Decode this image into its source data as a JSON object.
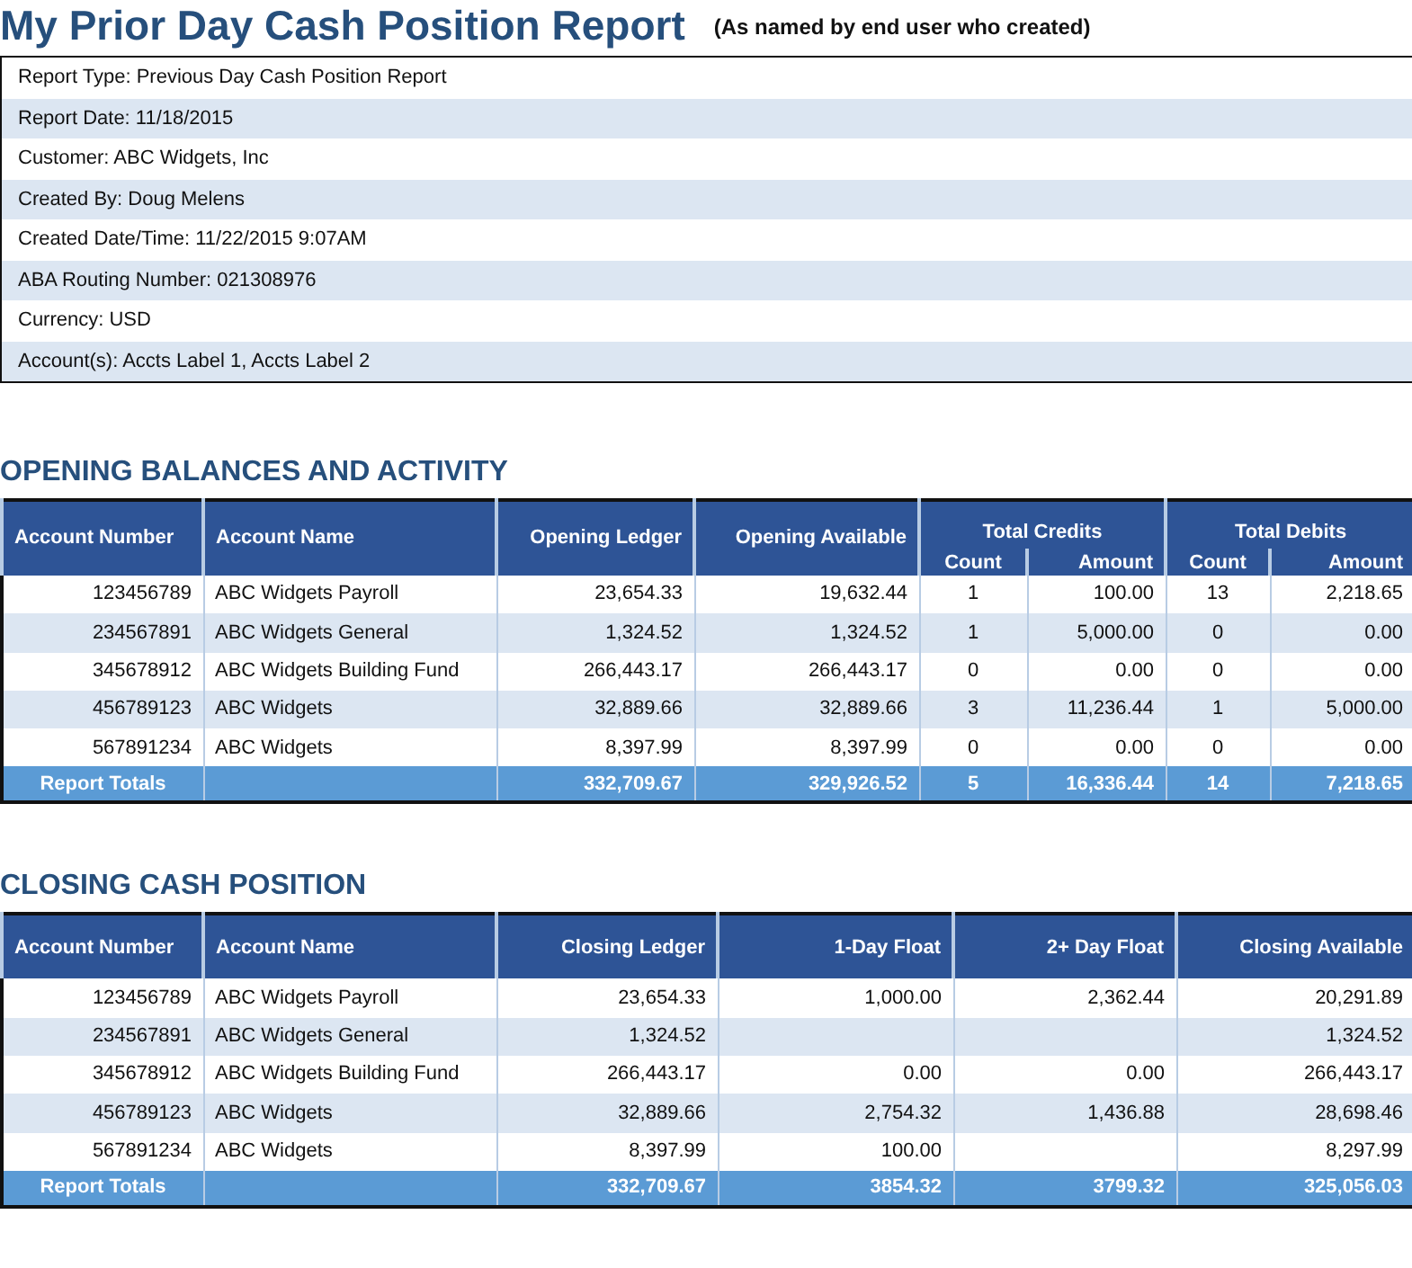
{
  "title": "My Prior Day Cash Position Report",
  "subtitle": "(As named by end user who created)",
  "info_lines": [
    "Report Type: Previous Day Cash Position Report",
    "Report Date:  11/18/2015",
    "Customer: ABC Widgets, Inc",
    "Created By: Doug Melens",
    "Created Date/Time: 11/22/2015 9:07AM",
    "ABA Routing Number: 021308976",
    "Currency: USD",
    "Account(s): Accts Label 1, Accts Label 2"
  ],
  "opening": {
    "heading": "OPENING BALANCES AND ACTIVITY",
    "columns": [
      {
        "label": "Account Number"
      },
      {
        "label": "Account Name"
      },
      {
        "label": "Opening Ledger"
      },
      {
        "label": "Opening Available"
      },
      {
        "label": "Total Credits",
        "sub": [
          "Count",
          "Amount"
        ]
      },
      {
        "label": "Total Debits",
        "sub": [
          "Count",
          "Amount"
        ]
      }
    ],
    "rows": [
      {
        "number": "123456789",
        "name": "ABC Widgets Payroll",
        "values": [
          "23,654.33",
          "19,632.44",
          "1",
          "100.00",
          "13",
          "2,218.65"
        ]
      },
      {
        "number": "234567891",
        "name": "ABC Widgets General",
        "values": [
          "1,324.52",
          "1,324.52",
          "1",
          "5,000.00",
          "0",
          "0.00"
        ]
      },
      {
        "number": "345678912",
        "name": "ABC Widgets Building Fund",
        "values": [
          "266,443.17",
          "266,443.17",
          "0",
          "0.00",
          "0",
          "0.00"
        ]
      },
      {
        "number": "456789123",
        "name": "ABC Widgets",
        "values": [
          "32,889.66",
          "32,889.66",
          "3",
          "11,236.44",
          "1",
          "5,000.00"
        ]
      },
      {
        "number": "567891234",
        "name": "ABC Widgets",
        "values": [
          "8,397.99",
          "8,397.99",
          "0",
          "0.00",
          "0",
          "0.00"
        ]
      }
    ],
    "totals": {
      "label": "Report Totals",
      "values": [
        "332,709.67",
        "329,926.52",
        "5",
        "16,336.44",
        "14",
        "7,218.65"
      ]
    }
  },
  "closing": {
    "heading": "CLOSING CASH POSITION",
    "columns": [
      {
        "label": "Account Number"
      },
      {
        "label": "Account Name"
      },
      {
        "label": "Closing Ledger"
      },
      {
        "label": "1-Day Float"
      },
      {
        "label": "2+ Day Float"
      },
      {
        "label": "Closing Available"
      }
    ],
    "rows": [
      {
        "number": "123456789",
        "name": "ABC Widgets Payroll",
        "closing_ledger": "23,654.33",
        "one_day_float": "1,000.00",
        "two_day_float": "2,362.44",
        "closing_available": "20,291.89"
      },
      {
        "number": "234567891",
        "name": "ABC Widgets General",
        "closing_ledger": "1,324.52",
        "closing_available": "1,324.52"
      },
      {
        "number": "345678912",
        "name": "ABC Widgets Building Fund",
        "closing_ledger": "266,443.17",
        "one_day_float": "0.00",
        "two_day_float": "0.00",
        "closing_available": "266,443.17"
      },
      {
        "number": "456789123",
        "name": "ABC Widgets",
        "closing_ledger": "32,889.66",
        "one_day_float": "2,754.32",
        "two_day_float": "1,436.88",
        "closing_available": "28,698.46"
      },
      {
        "number": "567891234",
        "name": "ABC Widgets",
        "closing_ledger": "8,397.99",
        "one_day_float": "100.00",
        "closing_available": "8,297.99"
      }
    ],
    "totals": {
      "label": "Report Totals",
      "values": [
        "332,709.67",
        "3854.32",
        "3799.32",
        "325,056.03"
      ]
    }
  }
}
